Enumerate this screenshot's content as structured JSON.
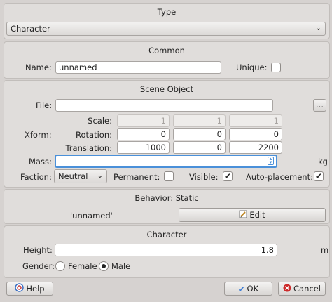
{
  "type_section": {
    "title": "Type",
    "selected": "Character"
  },
  "common": {
    "title": "Common",
    "name_label": "Name:",
    "name_value": "unnamed",
    "unique_label": "Unique:",
    "unique_checked": false
  },
  "scene_object": {
    "title": "Scene Object",
    "file_label": "File:",
    "file_value": "",
    "browse_label": "...",
    "xform_label": "Xform:",
    "scale_label": "Scale:",
    "rotation_label": "Rotation:",
    "translation_label": "Translation:",
    "scale": [
      "1",
      "1",
      "1"
    ],
    "rotation": [
      "0",
      "0",
      "0"
    ],
    "translation": [
      "1000",
      "0",
      "2200"
    ],
    "mass_label": "Mass:",
    "mass_value": "",
    "mass_unit": "kg",
    "faction_label": "Faction:",
    "faction_value": "Neutral",
    "permanent_label": "Permanent:",
    "permanent_checked": false,
    "visible_label": "Visible:",
    "visible_checked": true,
    "autoplacement_label": "Auto-placement:",
    "autoplacement_checked": true
  },
  "behavior": {
    "title": "Behavior: Static",
    "name_value": "'unnamed'",
    "edit_label": "Edit"
  },
  "character": {
    "title": "Character",
    "height_label": "Height:",
    "height_value": "1.8",
    "height_unit": "m",
    "gender_label": "Gender:",
    "female_label": "Female",
    "male_label": "Male",
    "selected_gender": "Male"
  },
  "footer": {
    "help_label": "Help",
    "ok_label": "OK",
    "cancel_label": "Cancel"
  },
  "icons": {
    "check": "✔",
    "chevron": "⌄"
  },
  "colors": {
    "focus": "#4a90d9",
    "ok_icon": "#3a7bd5",
    "cancel_icon": "#cc2b2b"
  }
}
